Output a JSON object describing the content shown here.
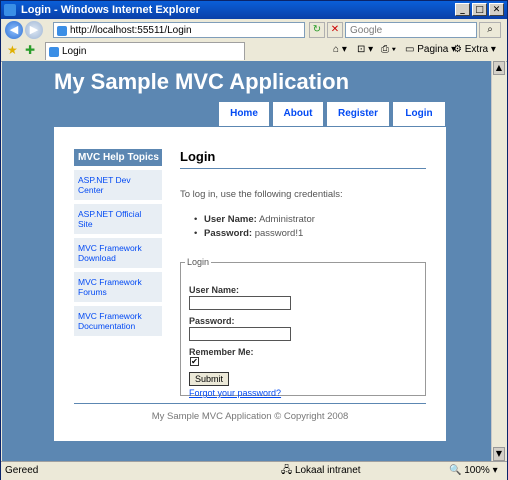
{
  "window": {
    "title": "Login - Windows Internet Explorer",
    "address": "http://localhost:55511/Login",
    "search_placeholder": "Google",
    "tab_title": "Login",
    "tools": {
      "page": "Pagina",
      "extra": "Extra"
    },
    "status_left": "Gereed",
    "status_zone": "Lokaal intranet",
    "zoom": "100%"
  },
  "app": {
    "title": "My Sample MVC Application",
    "menu": [
      "Home",
      "About",
      "Register",
      "Login"
    ]
  },
  "sidebar": {
    "heading": "MVC Help Topics",
    "items": [
      "ASP.NET Dev Center",
      "ASP.NET Official Site",
      "MVC Framework Download",
      "MVC Framework Forums",
      "MVC Framework Documentation"
    ]
  },
  "login": {
    "heading": "Login",
    "intro": "To log in, use the following credentials:",
    "credentials": [
      {
        "label": "User Name:",
        "value": "Administrator"
      },
      {
        "label": "Password:",
        "value": "password!1"
      }
    ],
    "legend": "Login",
    "username_label": "User Name:",
    "password_label": "Password:",
    "remember_label": "Remember Me:",
    "remember_checked": "✔",
    "submit_label": "Submit",
    "forgot_link": "Forgot your password?"
  },
  "footer": "My Sample MVC Application © Copyright 2008"
}
